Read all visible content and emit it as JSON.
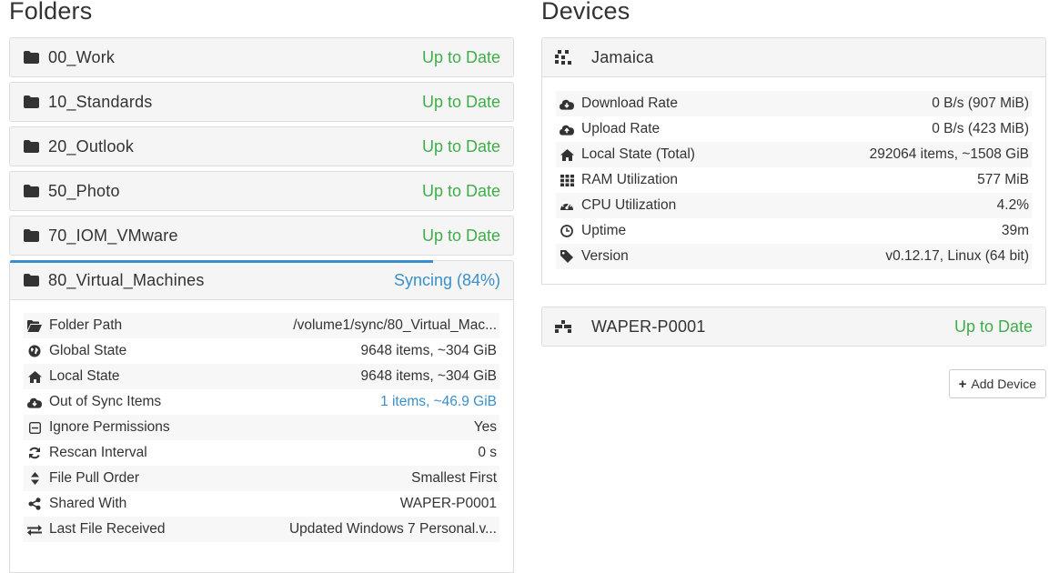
{
  "folders": {
    "heading": "Folders",
    "items": [
      {
        "name": "00_Work",
        "status": "Up to Date"
      },
      {
        "name": "10_Standards",
        "status": "Up to Date"
      },
      {
        "name": "20_Outlook",
        "status": "Up to Date"
      },
      {
        "name": "50_Photo",
        "status": "Up to Date"
      },
      {
        "name": "70_IOM_VMware",
        "status": "Up to Date"
      }
    ],
    "expanded": {
      "name": "80_Virtual_Machines",
      "status": "Syncing (84%)",
      "progress": 0.84,
      "details": [
        {
          "icon": "folder-open-icon",
          "label": "Folder Path",
          "value": "/volume1/sync/80_Virtual_Mac..."
        },
        {
          "icon": "globe-icon",
          "label": "Global State",
          "value": "9648 items, ~304 GiB"
        },
        {
          "icon": "home-icon",
          "label": "Local State",
          "value": "9648 items, ~304 GiB"
        },
        {
          "icon": "cloud-download-icon",
          "label": "Out of Sync Items",
          "value": "1 items, ~46.9 GiB"
        },
        {
          "icon": "minus-square-icon",
          "label": "Ignore Permissions",
          "value": "Yes"
        },
        {
          "icon": "refresh-icon",
          "label": "Rescan Interval",
          "value": "0 s"
        },
        {
          "icon": "sort-icon",
          "label": "File Pull Order",
          "value": "Smallest First"
        },
        {
          "icon": "share-icon",
          "label": "Shared With",
          "value": "WAPER-P0001"
        },
        {
          "icon": "exchange-icon",
          "label": "Last File Received",
          "value": "Updated Windows 7 Personal.v..."
        }
      ]
    }
  },
  "devices": {
    "heading": "Devices",
    "local": {
      "name": "Jamaica",
      "details": [
        {
          "icon": "cloud-download-icon",
          "label": "Download Rate",
          "value": "0 B/s (907 MiB)"
        },
        {
          "icon": "cloud-upload-icon",
          "label": "Upload Rate",
          "value": "0 B/s (423 MiB)"
        },
        {
          "icon": "home-icon",
          "label": "Local State (Total)",
          "value": "292064 items, ~1508 GiB"
        },
        {
          "icon": "th-icon",
          "label": "RAM Utilization",
          "value": "577 MiB"
        },
        {
          "icon": "dashboard-icon",
          "label": "CPU Utilization",
          "value": "4.2%"
        },
        {
          "icon": "clock-icon",
          "label": "Uptime",
          "value": "39m"
        },
        {
          "icon": "tag-icon",
          "label": "Version",
          "value": "v0.12.17, Linux (64 bit)"
        }
      ]
    },
    "remote": {
      "name": "WAPER-P0001",
      "status": "Up to Date"
    },
    "add_button": "Add Device"
  },
  "colors": {
    "ok": "#3fae49",
    "syncing": "#3a8fcb",
    "panel_bg": "#f5f5f5",
    "border": "#dddddd"
  }
}
